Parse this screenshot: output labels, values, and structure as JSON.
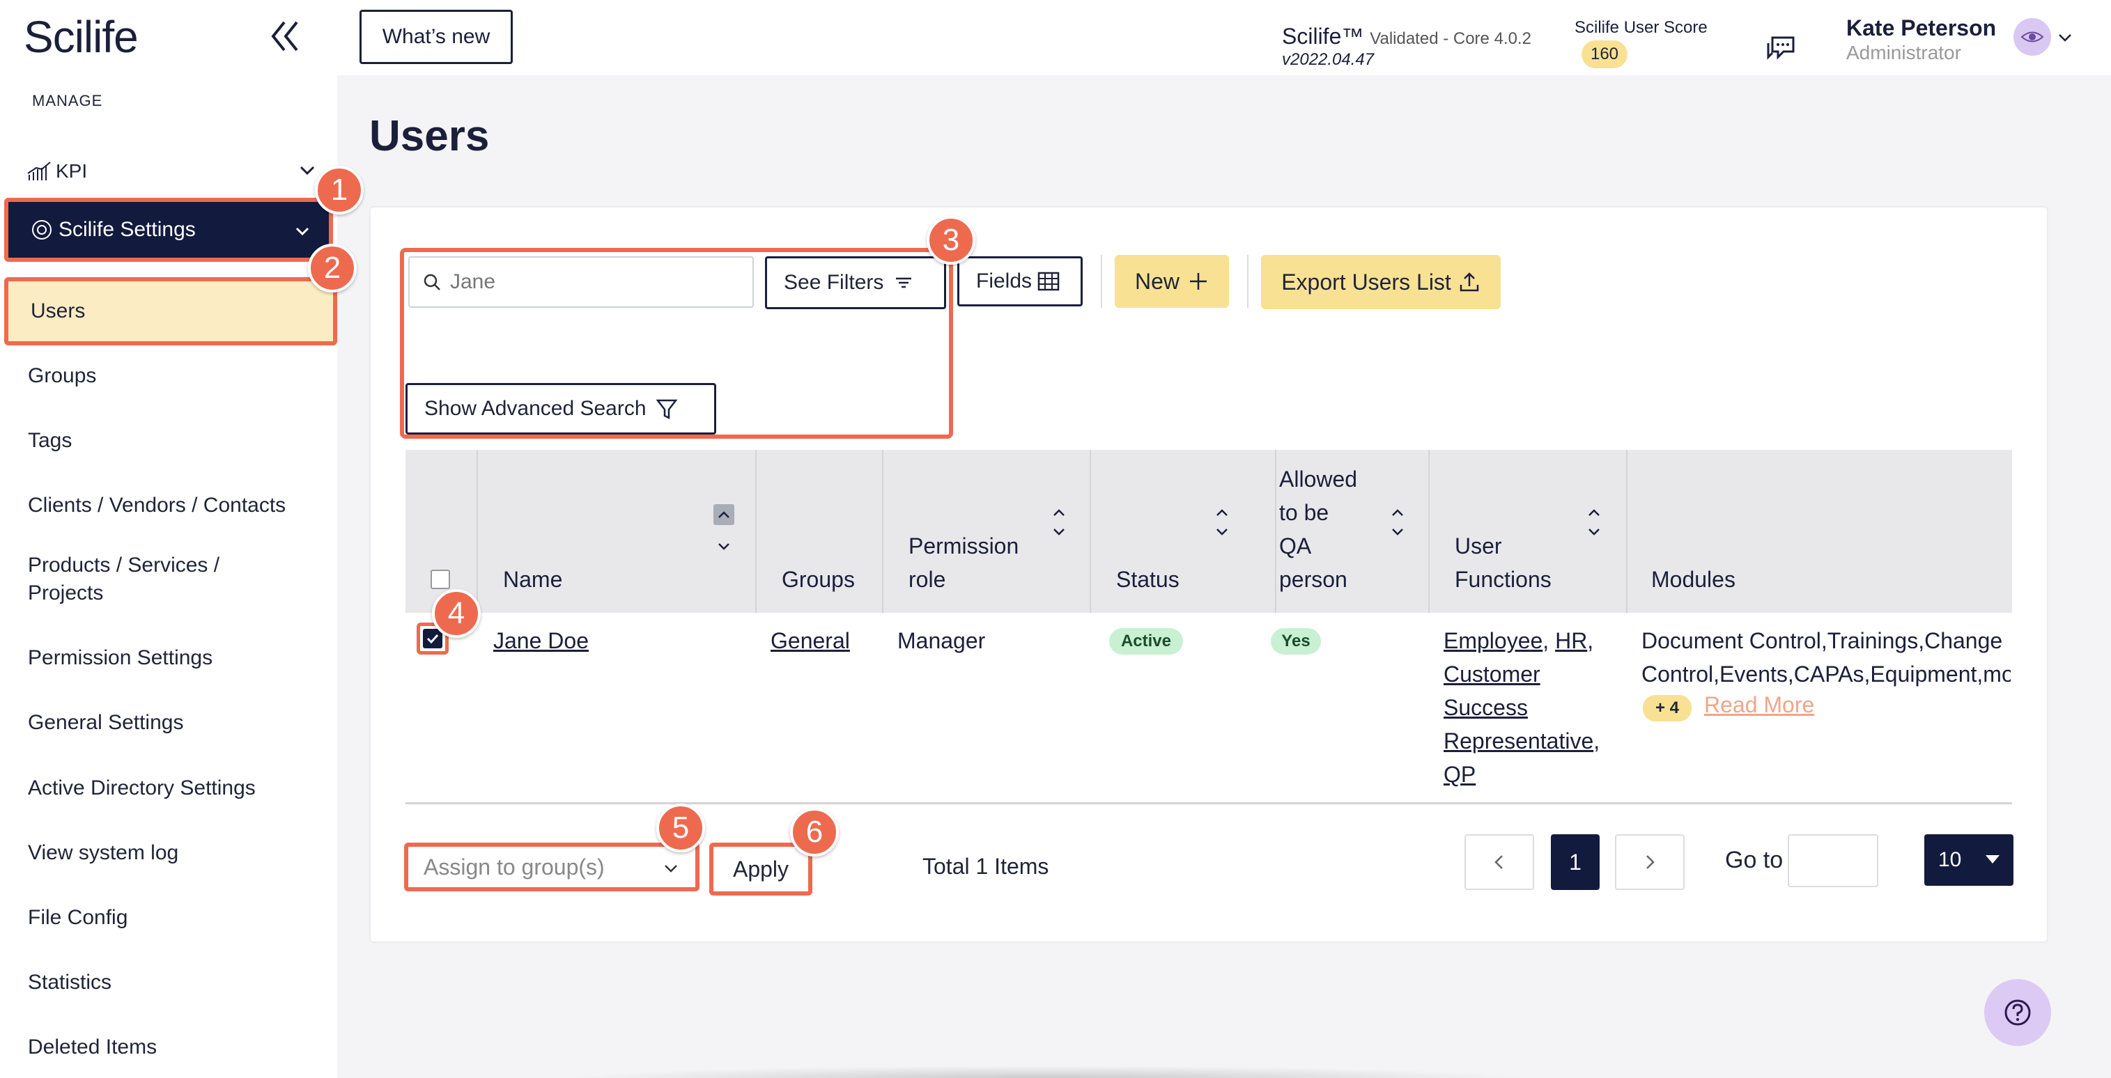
{
  "sidebar": {
    "logo": "Scilife",
    "section_label": "MANAGE",
    "kpi_label": "KPI",
    "settings_label": "Scilife Settings",
    "active_item": "Users",
    "items": [
      "Groups",
      "Tags",
      "Clients / Vendors / Contacts",
      "Products / Services / Projects",
      "Permission Settings",
      "General Settings",
      "Active Directory Settings",
      "View system log",
      "File Config",
      "Statistics",
      "Deleted Items"
    ]
  },
  "header": {
    "whats_new": "What’s new",
    "product": "Scilife™",
    "validated": "Validated - Core 4.0.2",
    "version": "v2022.04.47",
    "score_label": "Scilife User Score",
    "score_value": "160",
    "user_name": "Kate Peterson",
    "user_role": "Administrator"
  },
  "page": {
    "title": "Users"
  },
  "toolbar": {
    "search_placeholder": "Jane",
    "see_filters": "See Filters",
    "fields": "Fields",
    "new": "New",
    "export": "Export Users List",
    "advanced_search": "Show Advanced Search"
  },
  "table": {
    "columns": {
      "name": "Name",
      "groups": "Groups",
      "permission_role_1": "Permission",
      "permission_role_2": "role",
      "status": "Status",
      "qa_1": "Allowed",
      "qa_2": "to be",
      "qa_3": "QA",
      "qa_4": "person",
      "user_functions_1": "User",
      "user_functions_2": "Functions",
      "modules": "Modules"
    },
    "rows": [
      {
        "checked": true,
        "name": "Jane Doe",
        "group": "General",
        "role": "Manager",
        "status": "Active",
        "qa": "Yes",
        "functions": {
          "employee": "Employee",
          "hr": "HR",
          "customer": "Customer",
          "success": "Success",
          "representative": "Representative",
          "qp": "QP"
        },
        "modules_line1": "Document Control,Trainings,Change",
        "modules_line2": "Control,Events,CAPAs,Equipment,mo",
        "more_count": "+ 4",
        "read_more": "Read More"
      }
    ]
  },
  "footer": {
    "assign_placeholder": "Assign to group(s)",
    "apply": "Apply",
    "total": "Total 1 Items",
    "current_page": "1",
    "goto_label": "Go to",
    "page_size": "10"
  },
  "markers": [
    "1",
    "2",
    "3",
    "4",
    "5",
    "6"
  ],
  "colors": {
    "accent_navy": "#121a3d",
    "highlight_orange": "#ee6a4f",
    "yellow": "#f8e193",
    "active_bg": "#fcecc3",
    "status_green": "#c9f0d3"
  }
}
